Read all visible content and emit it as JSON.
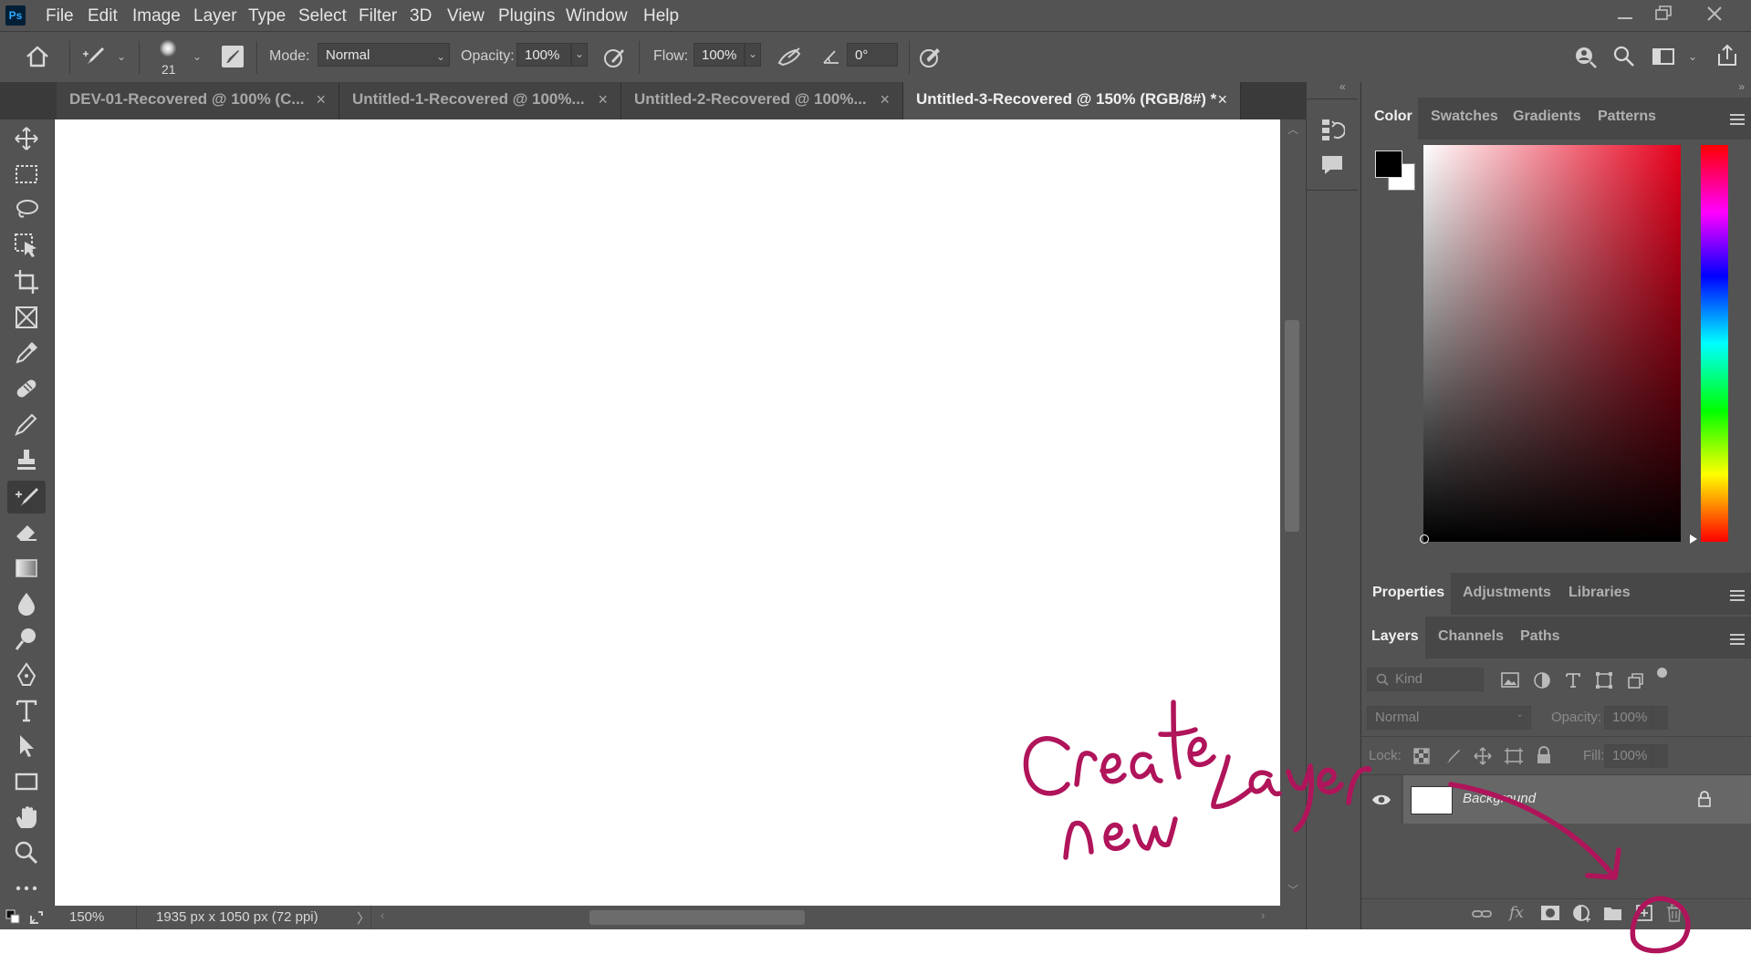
{
  "app": {
    "logo": "Ps"
  },
  "menu": [
    "File",
    "Edit",
    "Image",
    "Layer",
    "Type",
    "Select",
    "Filter",
    "3D",
    "View",
    "Plugins",
    "Window",
    "Help"
  ],
  "options": {
    "brush_size": "21",
    "mode_label": "Mode:",
    "mode_value": "Normal",
    "opacity_label": "Opacity:",
    "opacity_value": "100%",
    "flow_label": "Flow:",
    "flow_value": "100%",
    "angle_value": "0°"
  },
  "tabs": [
    {
      "label": "DEV-01-Recovered @ 100% (C...",
      "close": "×"
    },
    {
      "label": "Untitled-1-Recovered @ 100%...",
      "close": "×"
    },
    {
      "label": "Untitled-2-Recovered @ 100%...",
      "close": "×"
    },
    {
      "label": "Untitled-3-Recovered @ 150% (RGB/8#) *",
      "close": "×"
    }
  ],
  "status": {
    "zoom": "150%",
    "doc_size": "1935 px x 1050 px (72 ppi)"
  },
  "color_panel": {
    "tabs": [
      "Color",
      "Swatches",
      "Gradients",
      "Patterns"
    ],
    "foreground": "#000000",
    "background": "#ffffff",
    "hue_color": "#e8001c"
  },
  "properties_panel": {
    "tabs": [
      "Properties",
      "Adjustments",
      "Libraries"
    ]
  },
  "layers_panel": {
    "tabs": [
      "Layers",
      "Channels",
      "Paths"
    ],
    "filter_placeholder": "Kind",
    "blend_mode": "Normal",
    "opacity_label": "Opacity:",
    "opacity_value": "100%",
    "lock_label": "Lock:",
    "fill_label": "Fill:",
    "fill_value": "100%",
    "layers": [
      {
        "name": "Background",
        "visible": true,
        "locked": true
      }
    ]
  },
  "annotation": {
    "color": "#b0145a"
  }
}
